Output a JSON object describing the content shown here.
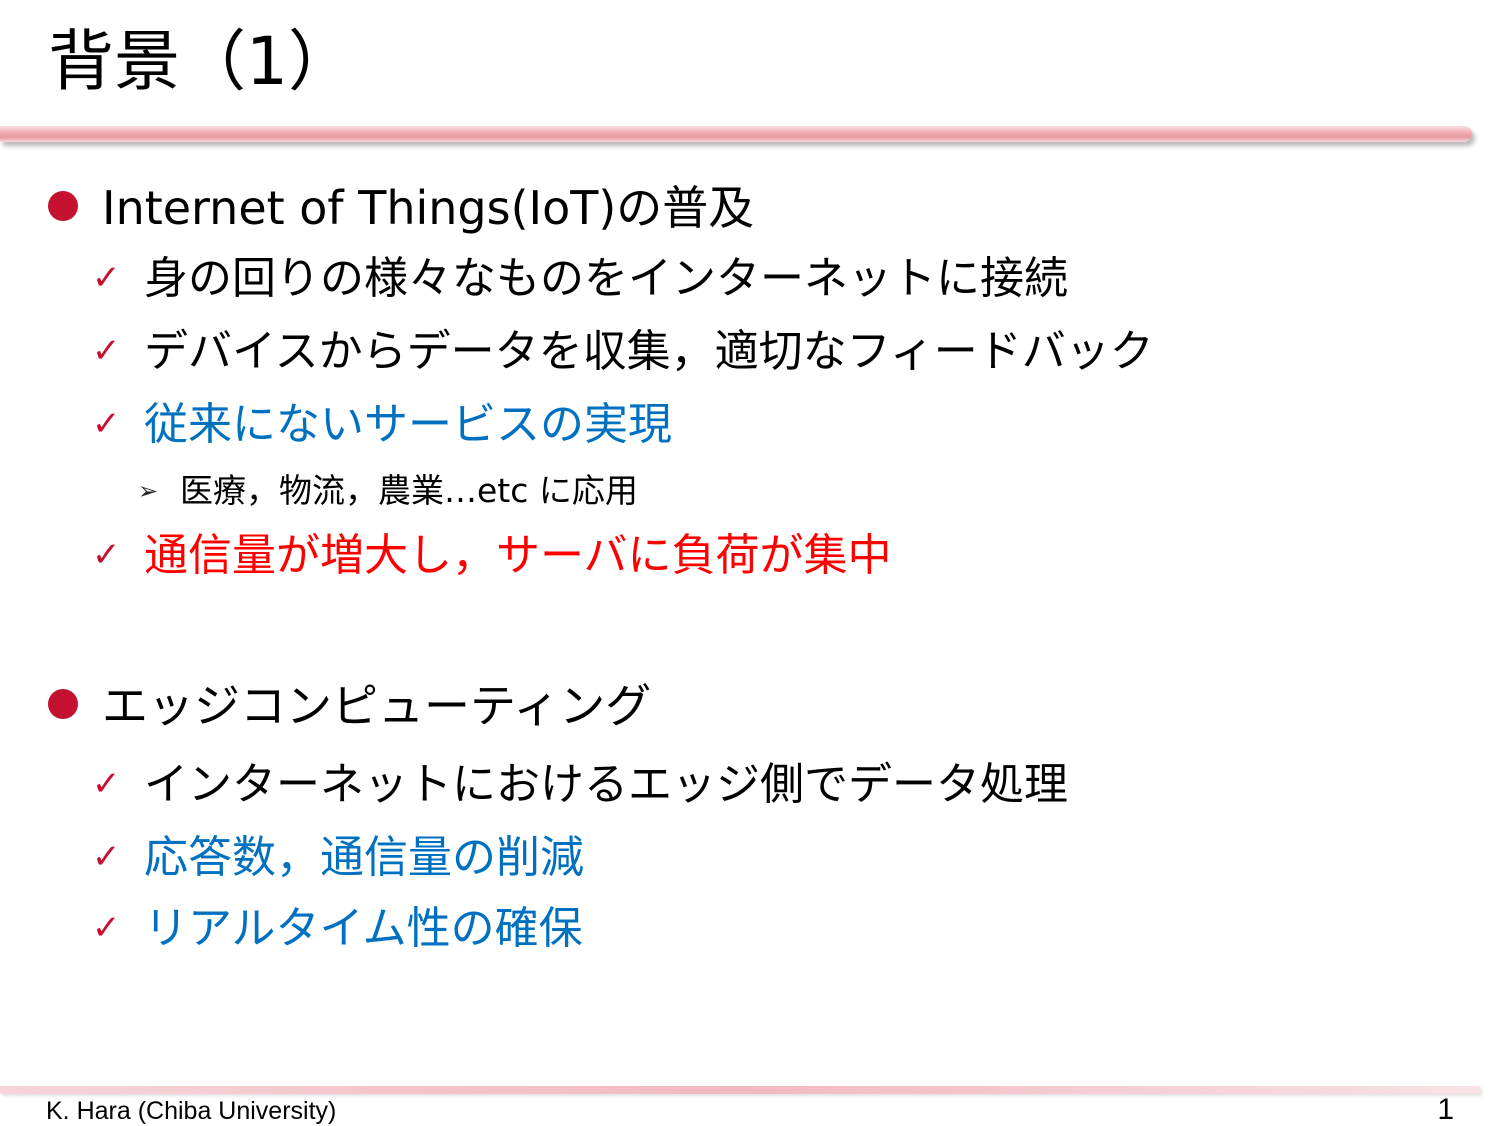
{
  "title": "背景（1）",
  "sections": [
    {
      "heading": "Internet of Thingsの普及",
      "heading_full": "Internet of Things(IoT)の普及",
      "items": [
        {
          "text": "身の回りの様々なものをインターネットに接続",
          "color": "#000000"
        },
        {
          "text": "デバイスからデータを収集，適切なフィードバック",
          "color": "#000000"
        },
        {
          "text": "従来にないサービスの実現",
          "color": "#0070c0",
          "subitems": [
            {
              "text": "医療，物流，農業…etc に応用",
              "color": "#000000"
            }
          ]
        },
        {
          "text": "通信量が増大し，サーバに負荷が集中",
          "color": "#ff0000"
        }
      ]
    },
    {
      "heading": "エッジコンピューティング",
      "items": [
        {
          "text": "インターネットにおけるエッジ側でデータ処理",
          "color": "#000000"
        },
        {
          "text": "応答数，通信量の削減",
          "color": "#0070c0"
        },
        {
          "text": "リアルタイム性の確保",
          "color": "#0070c0"
        }
      ]
    }
  ],
  "footer": {
    "author": "K. Hara (Chiba University)",
    "page_number": "1"
  },
  "icons": {
    "level1": "bullet-dot-icon",
    "level2": "check-mark-icon",
    "level3": "arrow-right-icon"
  },
  "colors": {
    "accent": "#c3112f",
    "blue": "#0070c0",
    "red": "#ff0000"
  }
}
